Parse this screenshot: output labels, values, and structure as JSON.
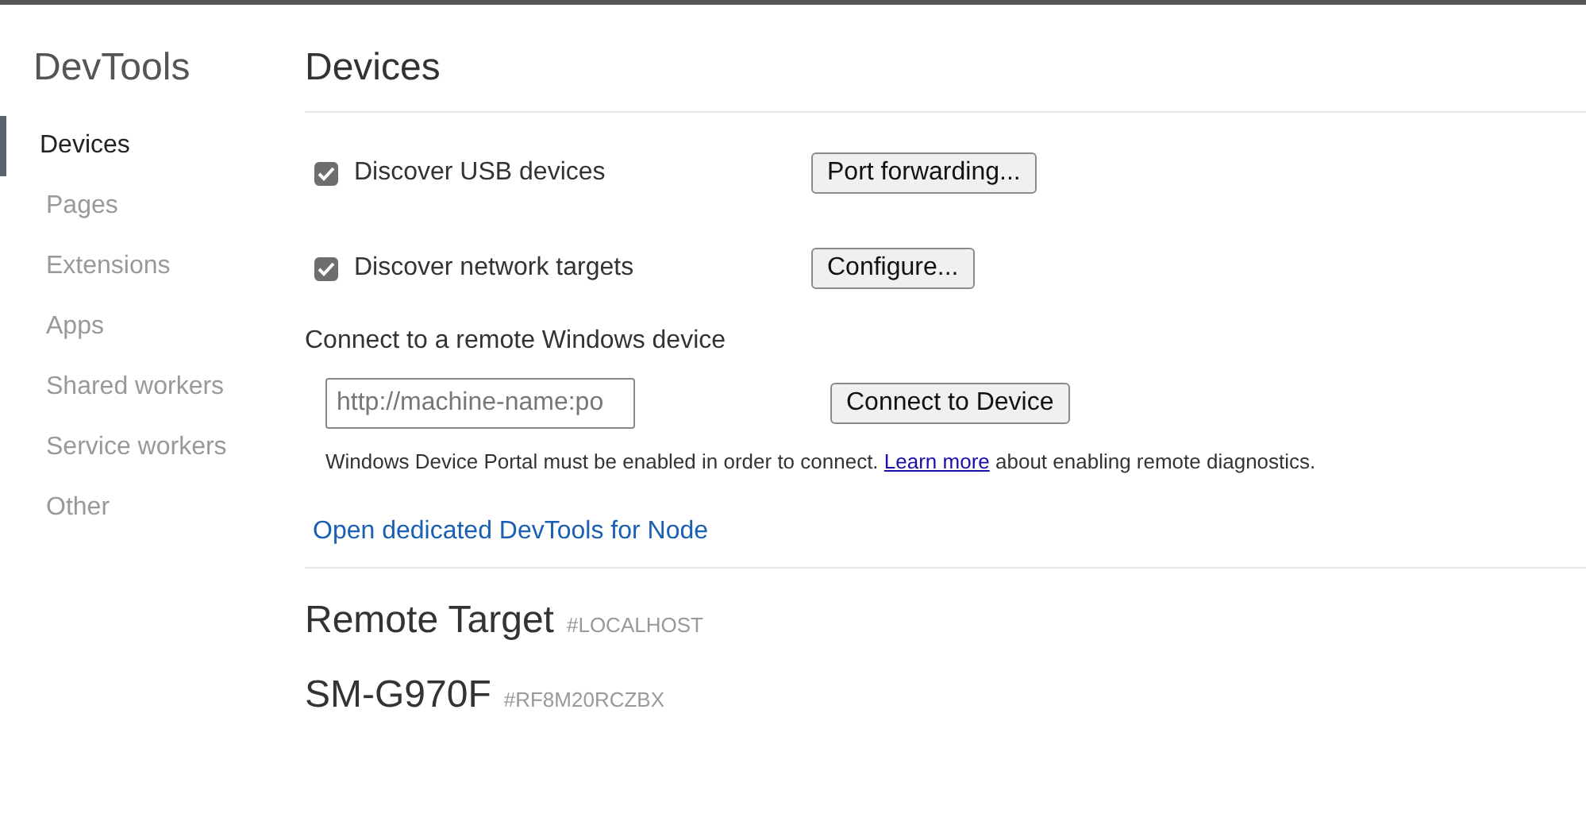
{
  "sidebar": {
    "title": "DevTools",
    "items": [
      {
        "label": "Devices",
        "selected": true
      },
      {
        "label": "Pages",
        "selected": false
      },
      {
        "label": "Extensions",
        "selected": false
      },
      {
        "label": "Apps",
        "selected": false
      },
      {
        "label": "Shared workers",
        "selected": false
      },
      {
        "label": "Service workers",
        "selected": false
      },
      {
        "label": "Other",
        "selected": false
      }
    ]
  },
  "main": {
    "title": "Devices",
    "options": [
      {
        "label": "Discover USB devices",
        "checked": true,
        "button": "Port forwarding..."
      },
      {
        "label": "Discover network targets",
        "checked": true,
        "button": "Configure..."
      }
    ],
    "remote_windows": {
      "heading": "Connect to a remote Windows device",
      "placeholder": "http://machine-name:po",
      "button": "Connect to Device",
      "help_before": "Windows Device Portal must be enabled in order to connect. ",
      "help_link": "Learn more",
      "help_after": " about enabling remote diagnostics."
    },
    "node_link": "Open dedicated DevTools for Node",
    "targets": [
      {
        "name": "Remote Target",
        "id": "#LOCALHOST"
      },
      {
        "name": "SM-G970F",
        "id": "#RF8M20RCZBX"
      }
    ]
  }
}
